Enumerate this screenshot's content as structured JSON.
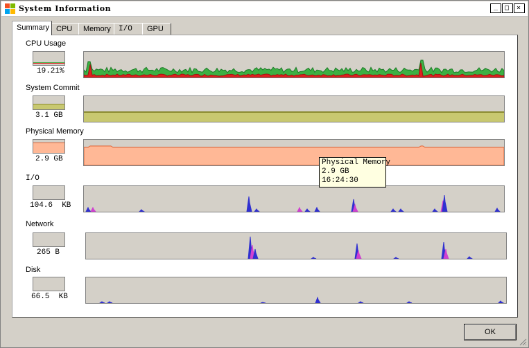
{
  "window": {
    "title": "System Information",
    "minimize_glyph": "_",
    "maximize_glyph": "□",
    "close_glyph": "×"
  },
  "tabs": [
    "Summary",
    "CPU",
    "Memory",
    "I/O",
    "GPU"
  ],
  "sections": {
    "cpu": {
      "label": "CPU Usage",
      "value": "19.21%"
    },
    "commit": {
      "label": "System Commit",
      "value": "3.1 GB"
    },
    "memory": {
      "label": "Physical Memory",
      "value": "2.9 GB"
    },
    "io": {
      "label": "I/O",
      "value": "104.6  KB"
    },
    "network": {
      "label": "Network",
      "value": "265 B"
    },
    "disk": {
      "label": "Disk",
      "value": "66.5  KB"
    }
  },
  "tooltip": {
    "line1": "Physical Memory",
    "line2": "2.9 GB",
    "line3": "16:24:30"
  },
  "buttons": {
    "ok": "OK"
  },
  "colors": {
    "cpu_total": "#3cb043",
    "cpu_kernel": "#e02020",
    "commit": "#c8c870",
    "memory": "#ffb896",
    "io_read": "#3030d0",
    "io_other": "#d040d0"
  }
}
